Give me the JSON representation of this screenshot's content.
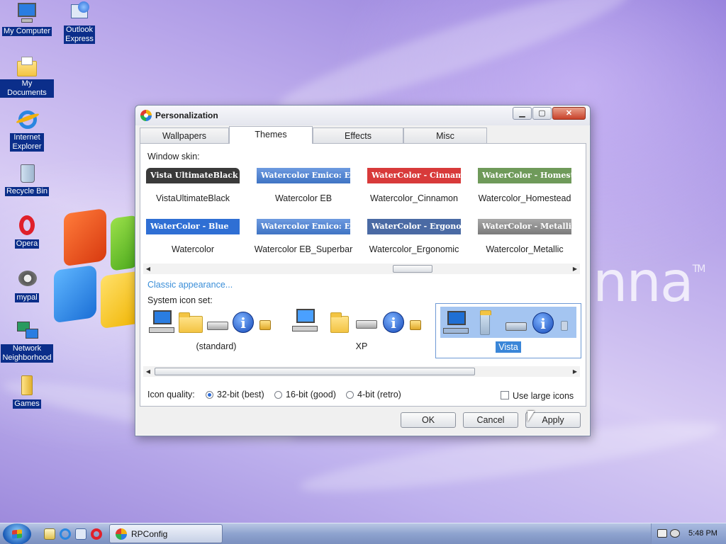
{
  "desktop": {
    "icons": [
      {
        "label": "My Computer",
        "icon": "computer-icon"
      },
      {
        "label": "Outlook Express",
        "icon": "outlook-icon"
      },
      {
        "label": "My Documents",
        "icon": "documents-folder-icon"
      },
      {
        "label": "Internet Explorer",
        "icon": "ie-icon"
      },
      {
        "label": "Recycle Bin",
        "icon": "recycle-bin-icon"
      },
      {
        "label": "Opera",
        "icon": "opera-icon"
      },
      {
        "label": "mypal",
        "icon": "mypal-icon"
      },
      {
        "label": "Network Neighborhood",
        "icon": "network-icon"
      },
      {
        "label": "Games",
        "icon": "games-folder-icon"
      }
    ],
    "brand_text": "nna",
    "brand_tm": "TM"
  },
  "window": {
    "title": "Personalization",
    "min_glyph": "▁",
    "max_glyph": "▢",
    "close_glyph": "✕",
    "tabs": [
      {
        "label": "Wallpapers",
        "active": false
      },
      {
        "label": "Themes",
        "active": true
      },
      {
        "label": "Effects",
        "active": false
      },
      {
        "label": "Misc",
        "active": false
      }
    ],
    "window_skin_label": "Window skin:",
    "skins": [
      {
        "bar_text": "Vista UltimateBlack",
        "name": "VistaUltimateBlack",
        "color": "#3a3a3a"
      },
      {
        "bar_text": "Watercolor Emico: Ergo",
        "name": "Watercolor EB",
        "color": "#3f74c4"
      },
      {
        "bar_text": "WaterColor - Cinnamon",
        "name": "Watercolor_Cinnamon",
        "color": "#d83a3a"
      },
      {
        "bar_text": "WaterColor - Homeste",
        "name": "Watercolor_Homestead",
        "color": "#6f9a5a"
      },
      {
        "bar_text": "WaterColor - Blue",
        "name": "Watercolor",
        "color": "#2f6fd4"
      },
      {
        "bar_text": "Watercolor Emico: Ergo",
        "name": "Watercolor EB_Superbar",
        "color": "#3f74c4"
      },
      {
        "bar_text": "WaterColor - Ergonom",
        "name": "Watercolor_Ergonomic",
        "color": "#4a6aa4"
      },
      {
        "bar_text": "WaterColor - Metallic",
        "name": "Watercolor_Metallic",
        "color": "#8a8a8a"
      }
    ],
    "classic_link": "Classic appearance...",
    "icon_set_label": "System icon set:",
    "icon_sets": [
      {
        "caption": "(standard)",
        "selected": false
      },
      {
        "caption": "XP",
        "selected": false
      },
      {
        "caption": "Vista",
        "selected": true
      }
    ],
    "icon_quality_label": "Icon quality:",
    "quality_options": [
      {
        "label": "32-bit (best)",
        "checked": true
      },
      {
        "label": "16-bit (good)",
        "checked": false
      },
      {
        "label": "4-bit (retro)",
        "checked": false
      }
    ],
    "large_icons_label": "Use large icons",
    "large_icons_checked": false,
    "buttons": {
      "ok": "OK",
      "cancel": "Cancel",
      "apply": "Apply"
    }
  },
  "taskbar": {
    "task_label": "RPConfig",
    "clock": "5:48 PM"
  }
}
